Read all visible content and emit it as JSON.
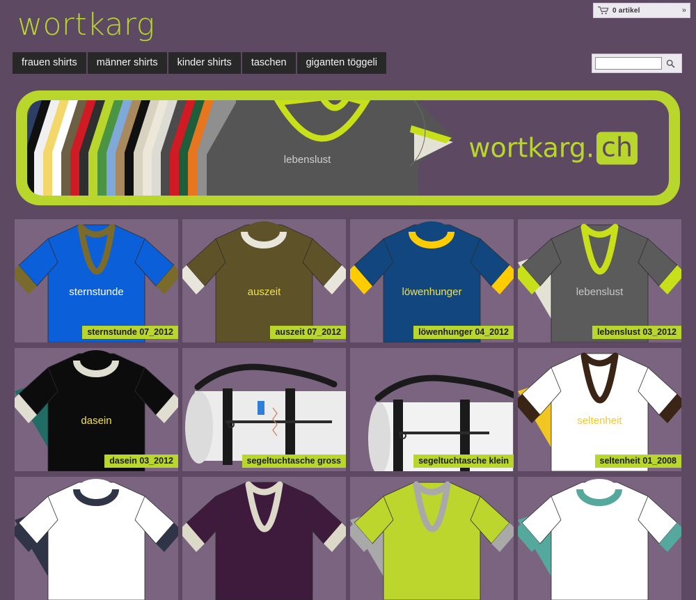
{
  "site": {
    "logo_text": "wortkarg",
    "background_color": "#5d4a62",
    "accent_color": "#b9d62c",
    "tile_color": "#7b6480"
  },
  "cart": {
    "icon": "shopping-cart-icon",
    "count_label": "0 artikel",
    "expand_label": "»"
  },
  "search": {
    "value": "",
    "placeholder": "",
    "icon": "search-icon"
  },
  "nav": {
    "items": [
      {
        "label": "frauen shirts"
      },
      {
        "label": "männer shirts"
      },
      {
        "label": "kinder shirts"
      },
      {
        "label": "taschen"
      },
      {
        "label": "giganten töggeli"
      }
    ]
  },
  "banner": {
    "shirt_text": "lebenslust",
    "brand_text": "wortkarg.",
    "brand_suffix": "ch",
    "fan_colors": [
      "#2c3e66",
      "#101010",
      "#f0f0f0",
      "#f4d76a",
      "#ffffff",
      "#6b6044",
      "#d01a24",
      "#2f2f2f",
      "#b9d62c",
      "#4a9443",
      "#7fa9d8",
      "#a98a5e",
      "#101010",
      "#d8d2c0",
      "#ece7d8",
      "#dcdcd4",
      "#4b4b4b",
      "#d01a24",
      "#1f5e3a",
      "#e8761f",
      "#8f8f8f"
    ]
  },
  "products": [
    {
      "name": "sternstunde",
      "label": "sternstunde 07_2012",
      "type": "vneck",
      "body": "#0b5fd8",
      "trim": "#7a6a2b",
      "text_color": "#ffffff",
      "band": null
    },
    {
      "name": "auszeit",
      "label": "auszeit 07_2012",
      "type": "round",
      "body": "#5e5228",
      "trim": "#e8e6db",
      "text_color": "#f2e24a",
      "band": null
    },
    {
      "name": "löwenhunger",
      "label": "löwenhunger 04_2012",
      "type": "round",
      "body": "#11477e",
      "trim": "#ffcc00",
      "text_color": "#f2e24a",
      "band": null
    },
    {
      "name": "lebenslust",
      "label": "lebenslust 03_2012",
      "type": "vneck",
      "body": "#5b5b5b",
      "trim": "#c8e019",
      "text_color": "#c7c7c7",
      "band": "#e4e2d5"
    },
    {
      "name": "dasein",
      "label": "dasein 03_2012",
      "type": "round",
      "body": "#0c0c0c",
      "trim": "#e0ded0",
      "text_color": "#f2e24a",
      "band": "#1f6d65"
    },
    {
      "name": "segeltuchtasche gross",
      "label": "segeltuchtasche gross",
      "type": "bag-large",
      "body": "#ececec",
      "trim": "#1a1a1a",
      "text_color": "#333333",
      "band": null
    },
    {
      "name": "segeltuchtasche klein",
      "label": "segeltuchtasche klein",
      "type": "bag-small",
      "body": "#f2f2f2",
      "trim": "#1a1a1a",
      "text_color": "#333333",
      "band": null
    },
    {
      "name": "seltenheit",
      "label": "seltenheit 01_2008",
      "type": "vneck",
      "body": "#ffffff",
      "trim": "#3a2415",
      "text_color": "#f2c832",
      "band": "#f2c620"
    },
    {
      "name": "",
      "label": "",
      "type": "round",
      "body": "#ffffff",
      "trim": "#2f3446",
      "text_color": "#333333",
      "band": "#2f3446"
    },
    {
      "name": "",
      "label": "",
      "type": "vneck",
      "body": "#3e1b3c",
      "trim": "#ddd9c8",
      "text_color": "#ffffff",
      "band": null
    },
    {
      "name": "",
      "label": "",
      "type": "vneck",
      "body": "#bcd62e",
      "trim": "#a9a9a9",
      "text_color": "#333333",
      "band": "#a9a9a9"
    },
    {
      "name": "",
      "label": "",
      "type": "round",
      "body": "#ffffff",
      "trim": "#55a89c",
      "text_color": "#333333",
      "band": "#55a89c"
    }
  ]
}
